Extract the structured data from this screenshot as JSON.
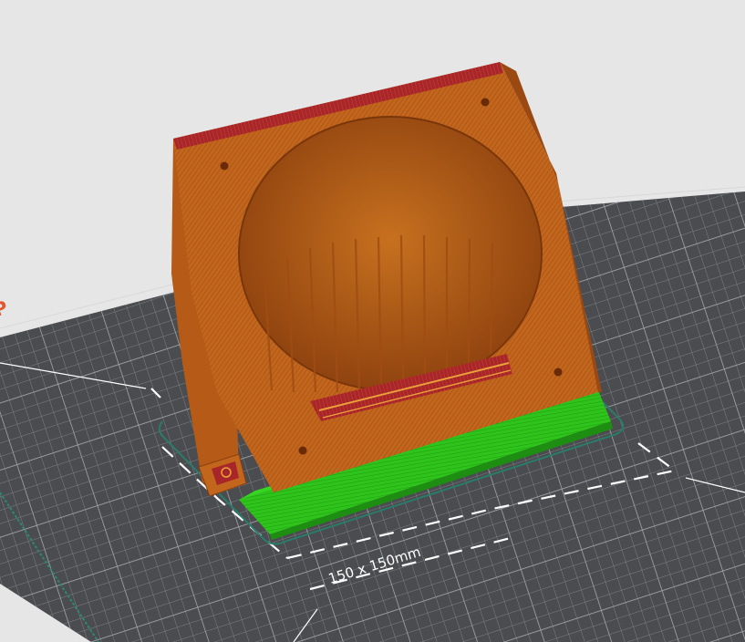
{
  "viewport": {
    "background": "#e6e6e6",
    "bed": {
      "size_label": "150 x 150mm",
      "surface_color": "#4b4c4f",
      "grid_color": "#8a8c90",
      "brand_partial_text": "P",
      "brand_color": "#e2572f"
    },
    "model": {
      "colors": {
        "perimeter": "#c2651d",
        "top_solid": "#a8262a",
        "support": "#2ec41b",
        "skirt": "#2a7c6a"
      }
    }
  }
}
